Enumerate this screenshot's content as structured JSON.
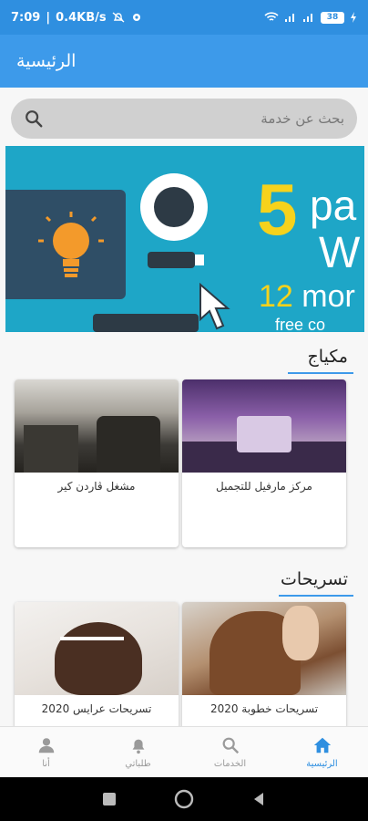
{
  "status": {
    "time": "7:09",
    "speed": "0.4KB/s",
    "battery": "38"
  },
  "app_bar": {
    "title": "الرئيسية"
  },
  "search": {
    "placeholder": "بحث عن خدمة"
  },
  "banner": {
    "big_number": "5",
    "text_pa": "pa",
    "text_w": "W",
    "text_12": "12",
    "text_mor": " mor",
    "text_free": "free co"
  },
  "sections": [
    {
      "title": "مكياج",
      "cards": [
        {
          "label": "مركز مارفيل للتجميل"
        },
        {
          "label": "مشغل ڤاردن كير"
        }
      ]
    },
    {
      "title": "تسريحات",
      "cards": [
        {
          "label": "تسريحات خطوبة 2020"
        },
        {
          "label": "تسريحات عرايس 2020"
        }
      ]
    }
  ],
  "bottom_nav": [
    {
      "label": "الرئيسية",
      "icon": "home-icon",
      "active": true
    },
    {
      "label": "الخدمات",
      "icon": "search-icon",
      "active": false
    },
    {
      "label": "طلباتي",
      "icon": "bell-icon",
      "active": false
    },
    {
      "label": "أنا",
      "icon": "person-icon",
      "active": false
    }
  ],
  "colors": {
    "primary": "#3d9aea",
    "status_bar": "#2f8fe0",
    "banner_bg": "#1ea6c7",
    "accent_yellow": "#f6d21c"
  }
}
